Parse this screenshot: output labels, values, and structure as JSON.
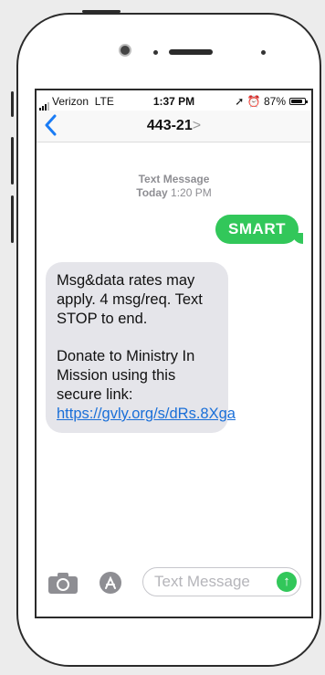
{
  "status_bar": {
    "carrier": "Verizon",
    "network": "LTE",
    "time": "1:37 PM",
    "battery": "87%",
    "battery_level": 0.87
  },
  "nav": {
    "back_glyph": "<",
    "contact": "443-21",
    "chevron": ">"
  },
  "thread_meta": {
    "label": "Text Message",
    "day": "Today",
    "time": "1:20 PM"
  },
  "outgoing": {
    "text": "SMART"
  },
  "incoming": {
    "line1": "Msg&data rates may apply. 4 msg/req. Text STOP to end.",
    "line2": "Donate to Ministry In Mission using this secure link: ",
    "link": "https://gvly.org/s/dRs.8Xga"
  },
  "composer": {
    "placeholder": "Text Message",
    "camera_icon": "camera-icon",
    "apps_icon": "app-store-icon",
    "send_icon": "send-arrow-icon"
  },
  "colors": {
    "ios_blue": "#1a7cf5",
    "imessage_green": "#32c75a",
    "incoming_bubble": "#e5e5ea"
  }
}
